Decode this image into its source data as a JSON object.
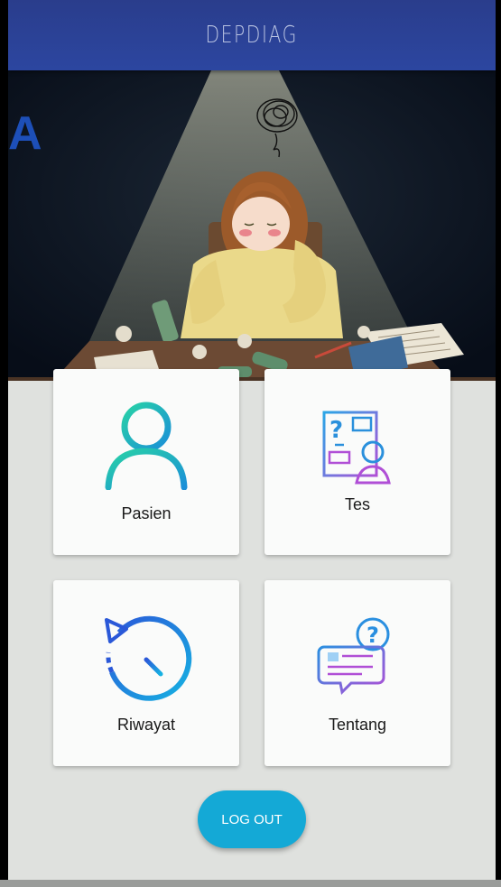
{
  "appbar": {
    "title": "DEPDIAG"
  },
  "hero": {
    "edge_letter": "A"
  },
  "menu": [
    {
      "id": "pasien",
      "label": "Pasien",
      "icon": "person-icon"
    },
    {
      "id": "tes",
      "label": "Tes",
      "icon": "test-form-icon"
    },
    {
      "id": "riwayat",
      "label": "Riwayat",
      "icon": "history-clock-icon"
    },
    {
      "id": "tentang",
      "label": "Tentang",
      "icon": "about-chat-question-icon"
    }
  ],
  "logout": {
    "label": "LOG OUT"
  },
  "colors": {
    "appbar": "#2c46a0",
    "accent": "#14a9d6",
    "background": "#dfe1de",
    "card": "#fafbfa"
  }
}
